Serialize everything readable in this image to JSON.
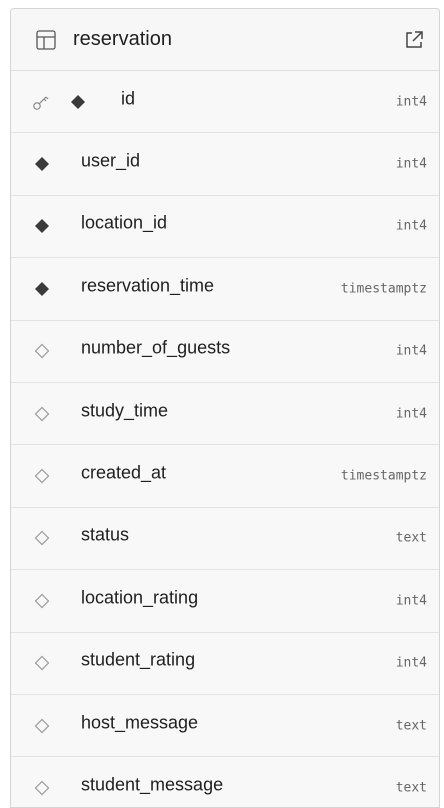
{
  "table": {
    "name": "reservation",
    "columns": [
      {
        "name": "id",
        "type": "int4",
        "primary_key": true,
        "required": true
      },
      {
        "name": "user_id",
        "type": "int4",
        "primary_key": false,
        "required": true
      },
      {
        "name": "location_id",
        "type": "int4",
        "primary_key": false,
        "required": true
      },
      {
        "name": "reservation_time",
        "type": "timestamptz",
        "primary_key": false,
        "required": true
      },
      {
        "name": "number_of_guests",
        "type": "int4",
        "primary_key": false,
        "required": false
      },
      {
        "name": "study_time",
        "type": "int4",
        "primary_key": false,
        "required": false
      },
      {
        "name": "created_at",
        "type": "timestamptz",
        "primary_key": false,
        "required": false
      },
      {
        "name": "status",
        "type": "text",
        "primary_key": false,
        "required": false
      },
      {
        "name": "location_rating",
        "type": "int4",
        "primary_key": false,
        "required": false
      },
      {
        "name": "student_rating",
        "type": "int4",
        "primary_key": false,
        "required": false
      },
      {
        "name": "host_message",
        "type": "text",
        "primary_key": false,
        "required": false
      },
      {
        "name": "student_message",
        "type": "text",
        "primary_key": false,
        "required": false
      }
    ]
  },
  "icons": {
    "table": "table-icon",
    "open": "external-link-icon",
    "primary_key": "key-icon",
    "required": "filled-diamond-icon",
    "nullable": "outline-diamond-icon"
  },
  "colors": {
    "header_bg": "#f7f7f7",
    "row_bg": "#f8f8f8",
    "border": "#d4d4d4",
    "text": "#1f1f1f",
    "type_text": "#666666",
    "diamond_fill": "#3a3a3a",
    "diamond_outline": "#9a9a9a"
  }
}
